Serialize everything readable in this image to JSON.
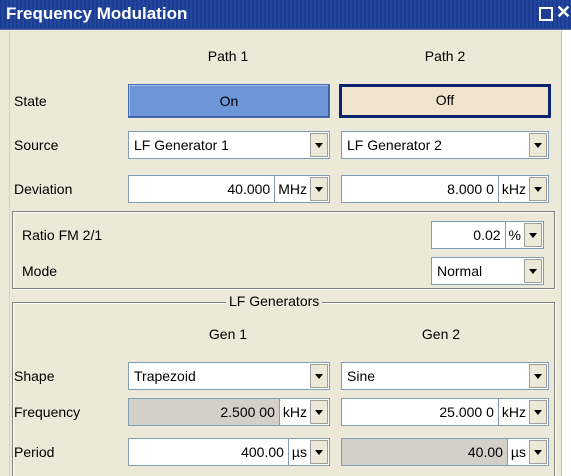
{
  "window": {
    "title": "Frequency Modulation"
  },
  "columns": {
    "path1": "Path 1",
    "path2": "Path 2"
  },
  "state": {
    "label": "State",
    "path1": "On",
    "path2": "Off"
  },
  "source": {
    "label": "Source",
    "path1": "LF Generator 1",
    "path2": "LF Generator 2"
  },
  "deviation": {
    "label": "Deviation",
    "path1": {
      "value": "40.000",
      "unit": "MHz"
    },
    "path2": {
      "value": "8.000 0",
      "unit": "kHz"
    }
  },
  "ratio": {
    "label": "Ratio FM 2/1",
    "value": "0.02",
    "unit": "%"
  },
  "mode": {
    "label": "Mode",
    "value": "Normal"
  },
  "lf_generators": {
    "title": "LF Generators",
    "gen1": "Gen 1",
    "gen2": "Gen 2",
    "shape": {
      "label": "Shape",
      "gen1": "Trapezoid",
      "gen2": "Sine"
    },
    "frequency": {
      "label": "Frequency",
      "gen1": {
        "value": "2.500 00",
        "unit": "kHz"
      },
      "gen2": {
        "value": "25.000 0",
        "unit": "kHz"
      }
    },
    "period": {
      "label": "Period",
      "gen1": {
        "value": "400.00",
        "unit": "µs"
      },
      "gen2": {
        "value": "40.00",
        "unit": "µs"
      }
    }
  },
  "icons": {
    "maximize": "maximize-icon",
    "close": "close-icon",
    "dropdown": "chevron-down-icon"
  }
}
